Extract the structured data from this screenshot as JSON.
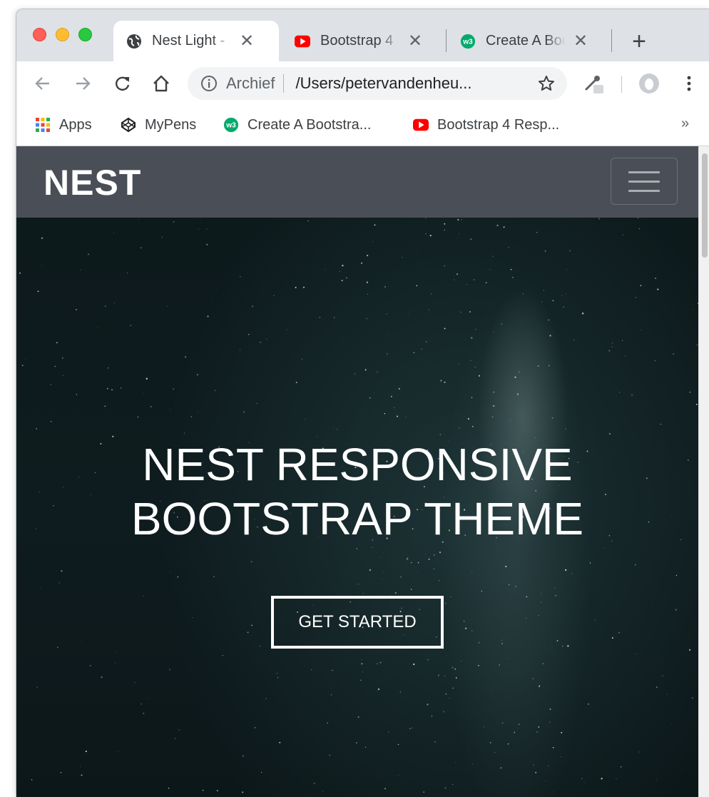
{
  "browser": {
    "tabs": [
      {
        "title": "Nest Light - ",
        "favicon": "globe-icon",
        "active": true
      },
      {
        "title": "Bootstrap 4 ",
        "favicon": "youtube-icon",
        "active": false
      },
      {
        "title": "Create A Boo",
        "favicon": "w3schools-icon",
        "active": false
      }
    ],
    "close_glyph": "✕",
    "new_tab_glyph": "+",
    "omnibox": {
      "scheme_label": "Archief",
      "url": "/Users/petervandenheu..."
    },
    "bookmarks": [
      {
        "label": "Apps",
        "icon": "apps-grid-icon"
      },
      {
        "label": "MyPens",
        "icon": "codepen-icon"
      },
      {
        "label": "Create A Bootstra...",
        "icon": "w3schools-icon"
      },
      {
        "label": "Bootstrap 4 Resp...",
        "icon": "youtube-icon"
      }
    ],
    "bookmarks_overflow": "»"
  },
  "page": {
    "brand": "NEST",
    "hero_line1": "NEST RESPONSIVE",
    "hero_line2": "BOOTSTRAP THEME",
    "cta_label": "GET STARTED"
  },
  "colors": {
    "navbar_bg": "#4a4f57",
    "hero_bg": "#0f1c1f",
    "text_white": "#ffffff",
    "youtube_red": "#ff0000",
    "w3_green": "#04aa6d"
  }
}
